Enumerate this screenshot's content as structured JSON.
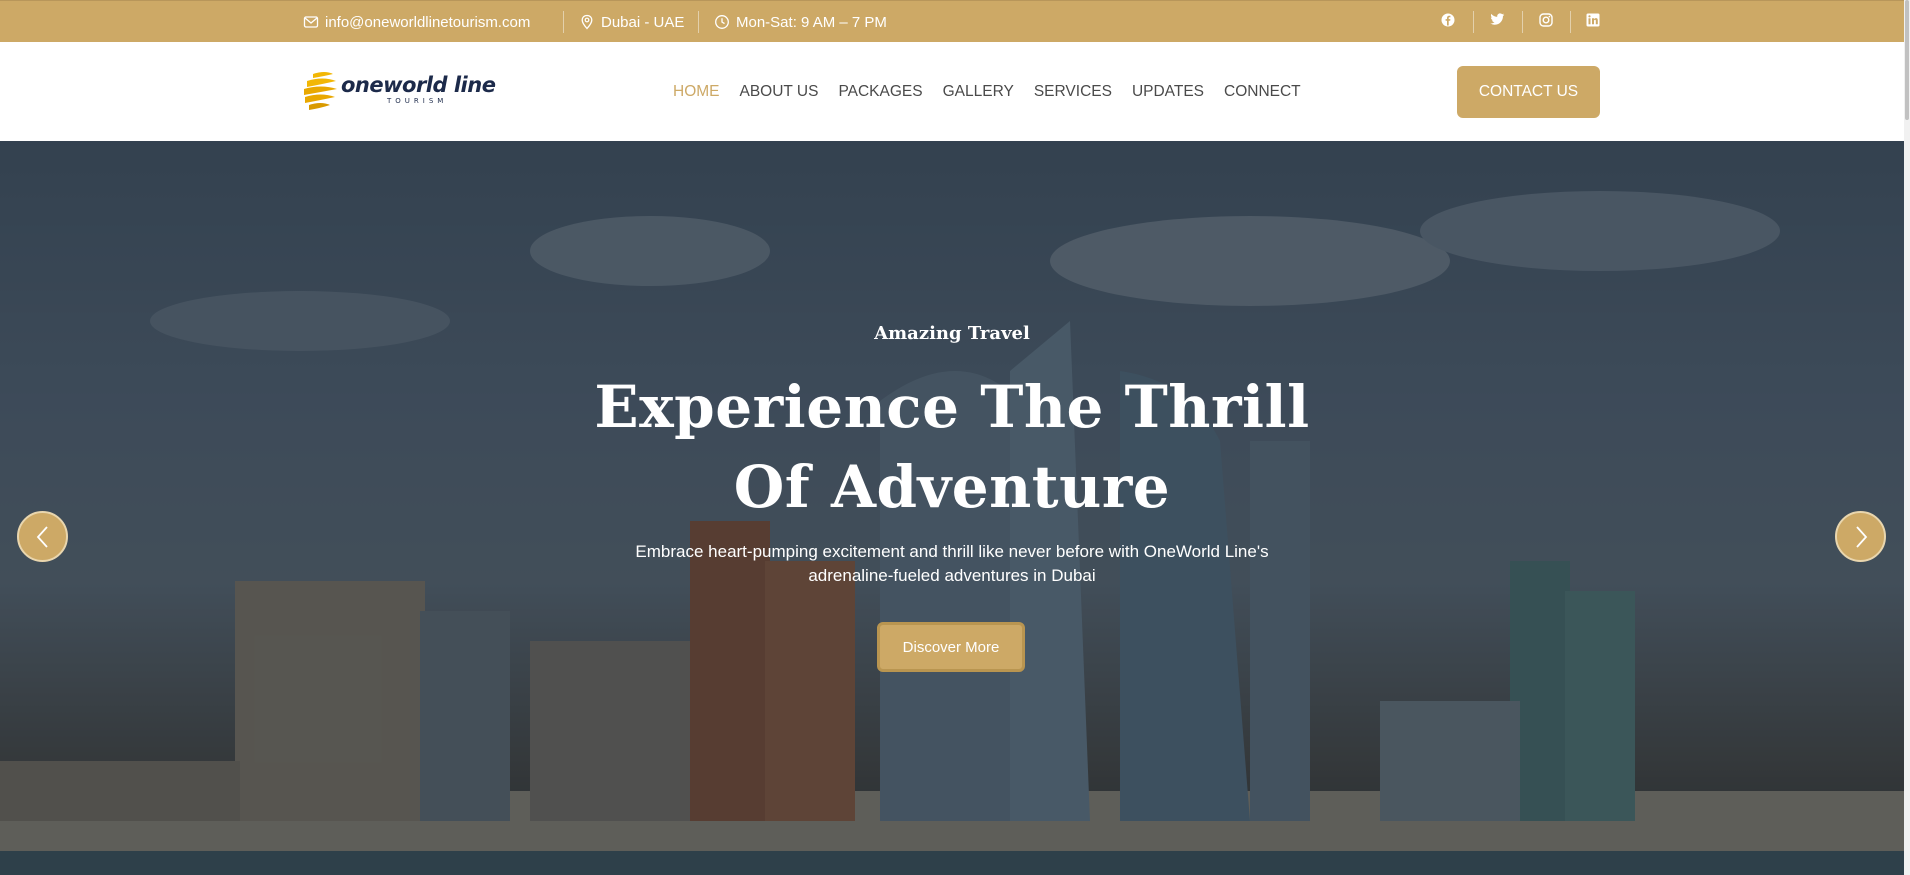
{
  "topbar": {
    "email": "info@oneworldlinetourism.com",
    "location": "Dubai - UAE",
    "hours": "Mon-Sat: 9 AM – 7 PM",
    "icons": {
      "email": "mail-icon",
      "location": "map-pin-icon",
      "hours": "clock-icon"
    },
    "social": [
      "facebook-icon",
      "twitter-icon",
      "instagram-icon",
      "linkedin-icon"
    ]
  },
  "header": {
    "logo": {
      "main": "oneworld line",
      "sub": "TOURISM"
    },
    "nav": [
      {
        "label": "HOME",
        "active": true
      },
      {
        "label": "ABOUT US",
        "active": false
      },
      {
        "label": "PACKAGES",
        "active": false
      },
      {
        "label": "GALLERY",
        "active": false
      },
      {
        "label": "SERVICES",
        "active": false
      },
      {
        "label": "UPDATES",
        "active": false
      },
      {
        "label": "CONNECT",
        "active": false
      }
    ],
    "cta_label": "CONTACT US"
  },
  "hero": {
    "kicker": "Amazing Travel",
    "headline": "Experience The Thrill Of Adventure",
    "description": "Embrace heart-pumping excitement and thrill like never before with OneWorld Line's adrenaline-fueled adventures in Dubai",
    "button_label": "Discover More",
    "prev_icon": "chevron-left-icon",
    "next_icon": "chevron-right-icon"
  },
  "colors": {
    "accent": "#cda966",
    "nav_active": "#cda966",
    "nav_text": "#4a4a4a",
    "logo_navy": "#1c2a4a",
    "logo_yellow": "#f2b705"
  }
}
